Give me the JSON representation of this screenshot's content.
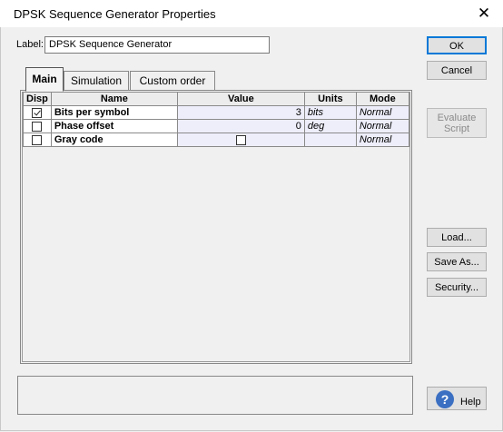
{
  "window": {
    "title": "DPSK Sequence Generator Properties",
    "close_glyph": "✕"
  },
  "label": {
    "caption": "Label:",
    "value": "DPSK Sequence Generator"
  },
  "buttons": {
    "ok": "OK",
    "cancel": "Cancel",
    "evaluate_script": "Evaluate Script",
    "load": "Load...",
    "save_as": "Save As...",
    "security": "Security...",
    "help": "Help",
    "help_icon_glyph": "?"
  },
  "tabs": [
    {
      "label": "Main",
      "active": true
    },
    {
      "label": "Simulation",
      "active": false
    },
    {
      "label": "Custom order",
      "active": false
    }
  ],
  "grid": {
    "headers": {
      "disp": "Disp",
      "name": "Name",
      "value": "Value",
      "units": "Units",
      "mode": "Mode"
    },
    "rows": [
      {
        "disp": true,
        "name": "Bits per symbol",
        "value": "3",
        "units": "bits",
        "mode": "Normal",
        "value_is_checkbox": false
      },
      {
        "disp": false,
        "name": "Phase offset",
        "value": "0",
        "units": "deg",
        "mode": "Normal",
        "value_is_checkbox": false
      },
      {
        "disp": false,
        "name": "Gray code",
        "value": false,
        "units": "",
        "mode": "Normal",
        "value_is_checkbox": true
      }
    ]
  }
}
